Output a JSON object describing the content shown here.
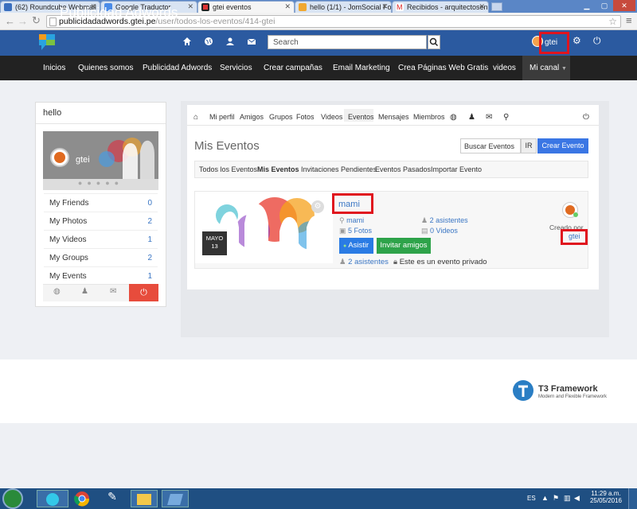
{
  "browser": {
    "tabs": [
      {
        "label": "(62) Roundcube Webmail"
      },
      {
        "label": "Google Traductor"
      },
      {
        "label": "gtei eventos"
      },
      {
        "label": "hello (1/1) - JomSocial Fo"
      },
      {
        "label": "Recibidos - arquitectosen"
      }
    ],
    "url_host": "publicidadadwords.gtei.pe",
    "url_path": "/user/todos-los-eventos/414-gtei"
  },
  "site": {
    "brand": "Publicidad Adwords",
    "search_placeholder": "Search",
    "username": "gtei",
    "nav": [
      "Inicios",
      "Quienes somos",
      "Publicidad Adwords",
      "Servicios",
      "Crear campañas",
      "Email Marketing",
      "Crea Páginas Web Gratis",
      "videos",
      "Mi canal"
    ]
  },
  "sidebar": {
    "title": "hello",
    "profile_name": "gtei",
    "items": [
      {
        "label": "My Friends",
        "count": "0"
      },
      {
        "label": "My Photos",
        "count": "2"
      },
      {
        "label": "My Videos",
        "count": "1"
      },
      {
        "label": "My Groups",
        "count": "2"
      },
      {
        "label": "My Events",
        "count": "1"
      }
    ]
  },
  "toolbar": {
    "items": [
      "Mi perfil",
      "Amigos",
      "Grupos",
      "Fotos",
      "Videos",
      "Eventos",
      "Mensajes",
      "Miembros"
    ]
  },
  "events": {
    "title": "Mis Eventos",
    "search_value": "Buscar Eventos",
    "ir_label": "IR",
    "create_label": "Crear Evento",
    "subtabs": [
      "Todos los Eventos",
      "Mis Eventos",
      "Invitaciones Pendientes",
      "Eventos Pasados",
      "Importar Evento"
    ],
    "event": {
      "name": "mami",
      "date_month": "MAYO",
      "date_day": "13",
      "location": "mami",
      "photos": "5 Fotos",
      "attendees": "2 asistentes",
      "videos": "0 Videos",
      "attend_btn": "Asistir",
      "invite_btn": "Invitar amigos",
      "attendees_bottom": "2 asistentes",
      "privacy": "Este es un evento privado",
      "created_by_label": "Creado por",
      "created_by_user": "gtei"
    }
  },
  "footer": {
    "framework_name": "T3 Framework",
    "framework_tagline": "Modern and Flexible Framework"
  },
  "taskbar": {
    "lang": "ES",
    "time": "11:29 a.m.",
    "date": "25/05/2016"
  },
  "colors": {
    "header": "#2b5aa0",
    "nav": "#222222",
    "accent": "#3a76c4",
    "asistir": "#2a7be4",
    "invitar": "#2ea34a",
    "highlight": "#e0141e",
    "power": "#e74c3c"
  }
}
